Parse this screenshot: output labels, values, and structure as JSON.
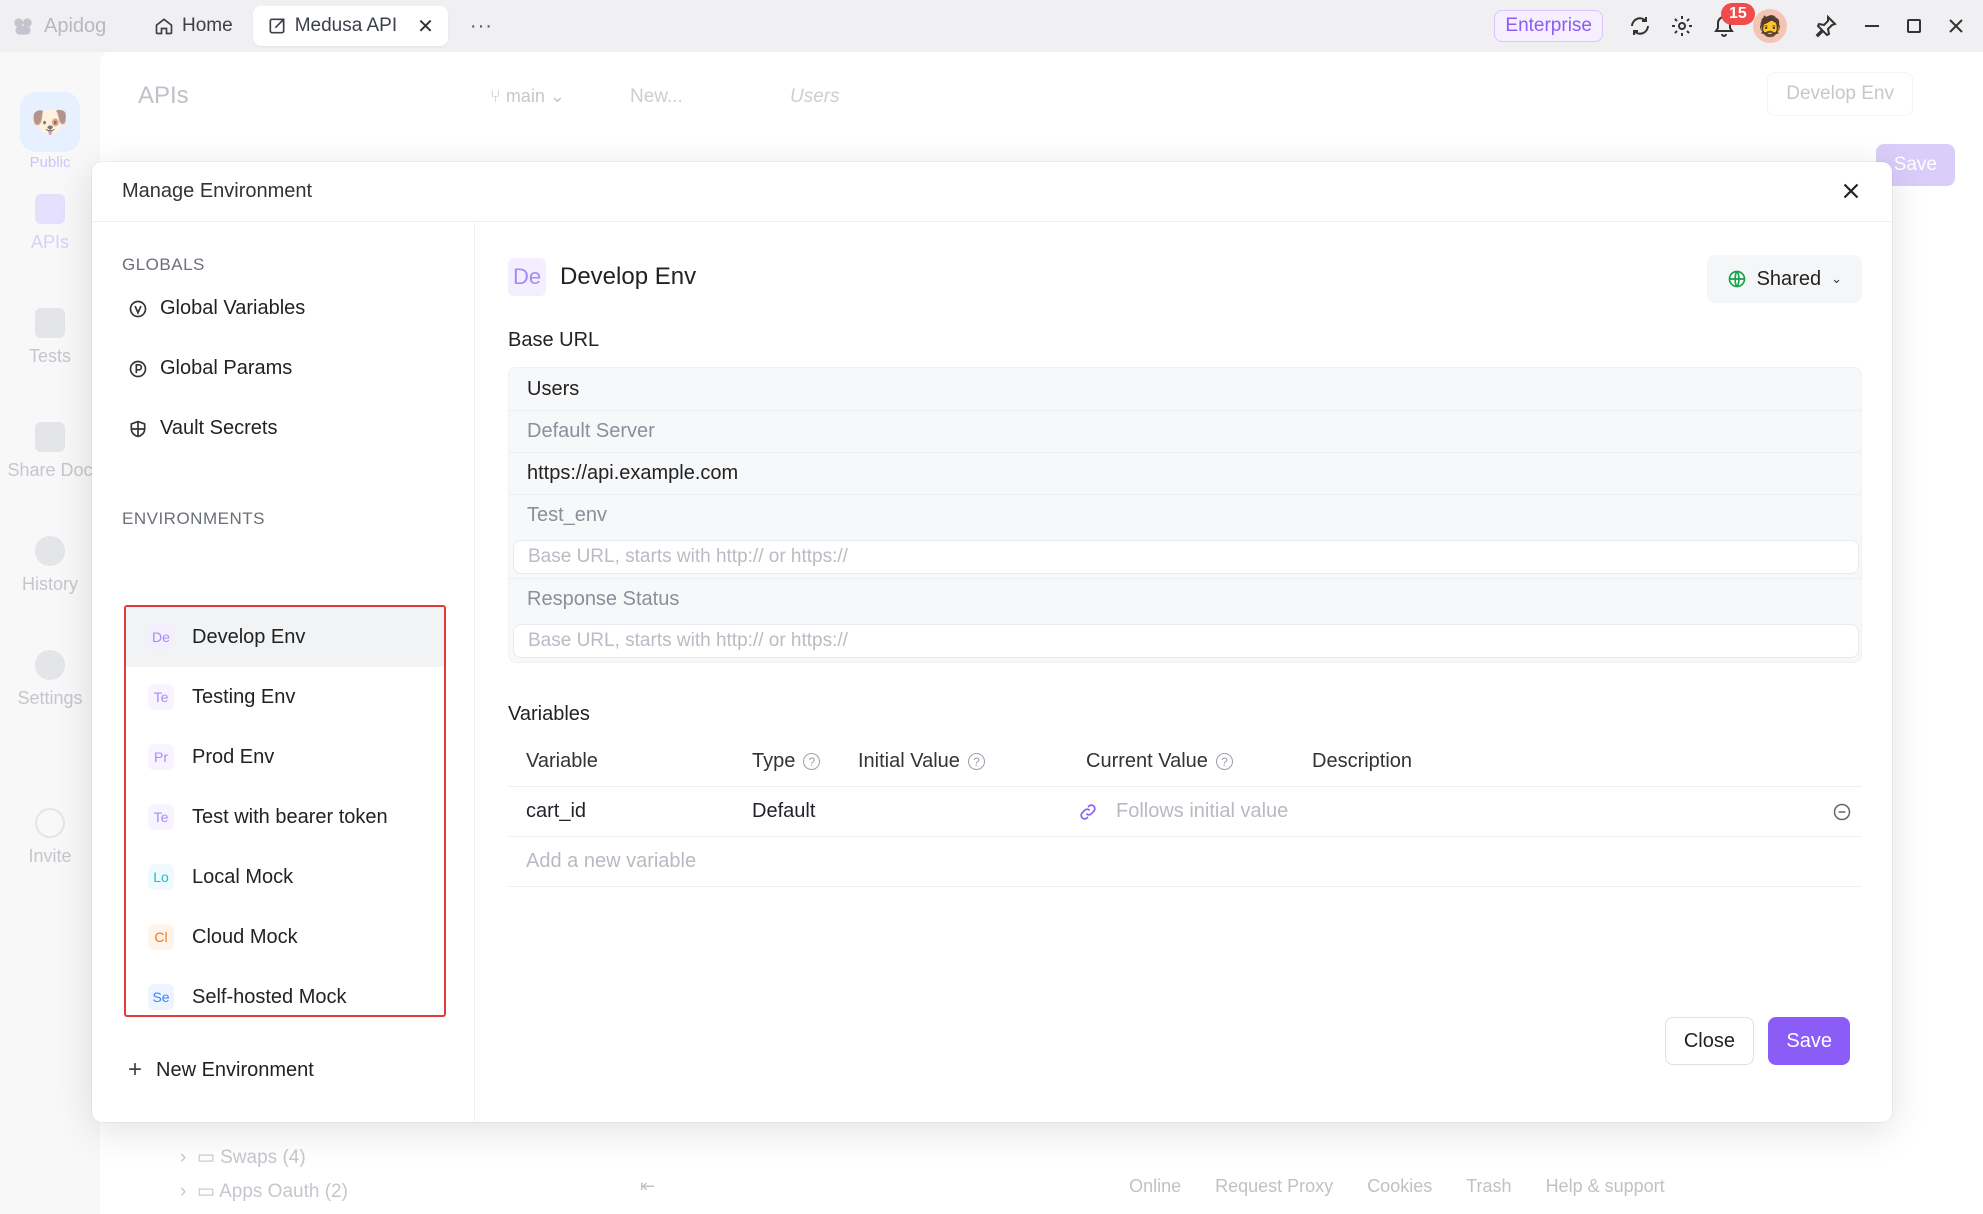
{
  "titlebar": {
    "brand": "Apidog",
    "tabs": [
      {
        "label": "Home"
      },
      {
        "label": "Medusa API"
      }
    ],
    "more": "···",
    "plan": "Enterprise",
    "notifications_count": "15"
  },
  "rail": {
    "public_label": "Public",
    "items": [
      {
        "label": "APIs"
      },
      {
        "label": "Tests"
      },
      {
        "label": "Share Doc"
      },
      {
        "label": "History"
      },
      {
        "label": "Settings"
      },
      {
        "label": "Invite"
      }
    ]
  },
  "background": {
    "title": "APIs",
    "branch": "main",
    "tabs": [
      "New...",
      "Users"
    ],
    "env_selector": "Develop Env",
    "save_label": "Save",
    "tree": [
      {
        "label": "Swaps",
        "count": "(4)"
      },
      {
        "label": "Apps Oauth",
        "count": "(2)"
      }
    ],
    "footer": [
      "Online",
      "Request Proxy",
      "Cookies",
      "Trash",
      "Help & support"
    ]
  },
  "modal": {
    "title": "Manage Environment",
    "globals_heading": "GLOBALS",
    "globals": [
      {
        "label": "Global Variables",
        "icon": "variable-icon"
      },
      {
        "label": "Global Params",
        "icon": "param-icon"
      },
      {
        "label": "Vault Secrets",
        "icon": "shield-icon"
      }
    ],
    "environments_heading": "ENVIRONMENTS",
    "environments": [
      {
        "abbr": "De",
        "label": "Develop Env",
        "color": "#a78bfa",
        "bg": "#f4efff"
      },
      {
        "abbr": "Te",
        "label": "Testing Env",
        "color": "#a78bfa",
        "bg": "#f7f4ff"
      },
      {
        "abbr": "Pr",
        "label": "Prod Env",
        "color": "#a78bfa",
        "bg": "#f7f4ff"
      },
      {
        "abbr": "Te",
        "label": "Test with bearer token",
        "color": "#a78bfa",
        "bg": "#f7f4ff"
      },
      {
        "abbr": "Lo",
        "label": "Local Mock",
        "color": "#22b8cf",
        "bg": "#eefafc"
      },
      {
        "abbr": "Cl",
        "label": "Cloud Mock",
        "color": "#f97316",
        "bg": "#fff4ec"
      },
      {
        "abbr": "Se",
        "label": "Self-hosted Mock",
        "color": "#3b82f6",
        "bg": "#eef4ff"
      }
    ],
    "new_environment": "New Environment",
    "selected_env": {
      "abbr": "De",
      "name": "Develop Env",
      "share_label": "Shared"
    },
    "base_url_label": "Base URL",
    "base_urls": {
      "group": "Users",
      "rows": [
        {
          "name": "Default Server",
          "value": "https://api.example.com"
        },
        {
          "name": "Test_env",
          "placeholder": "Base URL, starts with http:// or https://"
        },
        {
          "name": "Response Status",
          "placeholder": "Base URL, starts with http:// or https://"
        }
      ]
    },
    "variables_label": "Variables",
    "columns": [
      "Variable",
      "Type",
      "Initial Value",
      "Current Value",
      "Description"
    ],
    "variables": [
      {
        "name": "cart_id",
        "type": "Default",
        "initial": "",
        "current_placeholder": "Follows initial value",
        "description": ""
      }
    ],
    "add_variable_placeholder": "Add a new variable",
    "close_label": "Close",
    "save_label": "Save"
  },
  "colors": {
    "accent": "#8b5cf6",
    "highlight_border": "#e23b3b",
    "shared_globe": "#16a34a"
  }
}
